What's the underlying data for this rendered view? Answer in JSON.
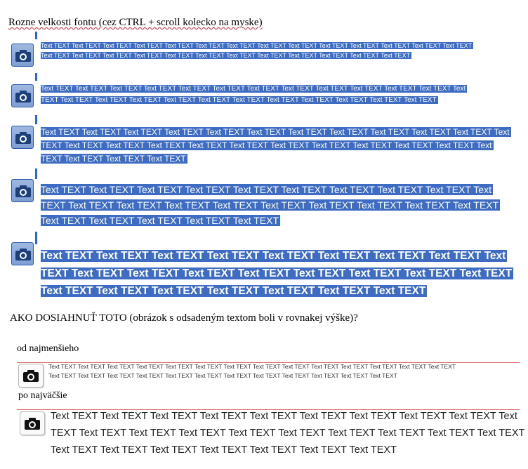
{
  "heading1": "Rozne velkosti fontu (cez CTRL + scroll kolecko na myske)",
  "heading2": "AKO DOSIAHNUŤ TOTO (obrázok s odsadeným textom boli v rovnakej výške)?",
  "label_small": "od najmenšieho",
  "label_large": "po najväčšie",
  "icon": "camera-icon",
  "colors": {
    "selection": "#3e6cc3",
    "rule": "#e06060"
  },
  "samples": {
    "s1": [
      "Text TEXT Text TEXT Text TEXT Text TEXT Text TEXT Text TEXT Text TEXT Text TEXT Text TEXT Text TEXT Text TEXT Text TEXT Text TEXT Text TEXT",
      "Text TEXT Text TEXT Text TEXT Text TEXT Text TEXT Text TEXT Text TEXT Text TEXT Text TEXT Text TEXT Text TEXT Text TEXT"
    ],
    "s2": [
      "Text TEXT Text TEXT Text TEXT Text TEXT Text TEXT Text TEXT Text TEXT Text TEXT Text TEXT Text TEXT Text TEXT Text TEXT Text",
      "TEXT Text TEXT Text TEXT Text TEXT Text TEXT Text TEXT Text TEXT Text TEXT Text TEXT Text TEXT Text TEXT Text TEXT"
    ],
    "s3": [
      "Text TEXT Text TEXT Text TEXT Text TEXT Text TEXT Text TEXT Text TEXT Text TEXT Text TEXT Text TEXT Text TEXT Text",
      "TEXT Text TEXT Text TEXT Text TEXT Text TEXT Text TEXT Text TEXT Text TEXT Text TEXT Text TEXT Text TEXT Text",
      "TEXT Text TEXT Text TEXT Text TEXT"
    ],
    "s4": [
      "Text TEXT Text TEXT Text TEXT Text TEXT Text TEXT Text TEXT Text TEXT Text TEXT Text TEXT Text",
      "TEXT Text TEXT Text TEXT Text TEXT Text TEXT Text TEXT Text TEXT Text TEXT Text TEXT Text TEXT",
      "Text TEXT Text TEXT Text TEXT Text TEXT Text TEXT"
    ],
    "s5": [
      "Text TEXT Text TEXT Text TEXT Text TEXT Text TEXT Text TEXT Text TEXT Text TEXT Text",
      "TEXT Text TEXT Text TEXT Text TEXT Text TEXT Text TEXT Text TEXT Text TEXT Text TEXT",
      "Text TEXT Text TEXT Text TEXT Text TEXT Text TEXT Text TEXT Text TEXT"
    ],
    "d1": [
      "Text TEXT Text TEXT Text TEXT Text TEXT Text TEXT Text TEXT Text TEXT Text TEXT Text TEXT Text TEXT Text TEXT Text TEXT Text TEXT Text TEXT",
      "Text TEXT Text TEXT Text TEXT Text TEXT Text TEXT Text TEXT Text TEXT Text TEXT Text TEXT Text TEXT Text TEXT Text TEXT"
    ],
    "d2": [
      "Text TEXT Text TEXT Text TEXT Text TEXT Text TEXT Text TEXT Text TEXT Text TEXT Text TEXT Text",
      "TEXT Text TEXT Text TEXT Text TEXT Text TEXT Text TEXT Text TEXT Text TEXT Text TEXT Text TEXT",
      "Text TEXT Text TEXT Text TEXT Text TEXT Text TEXT Text TEXT Text TEXT"
    ]
  }
}
